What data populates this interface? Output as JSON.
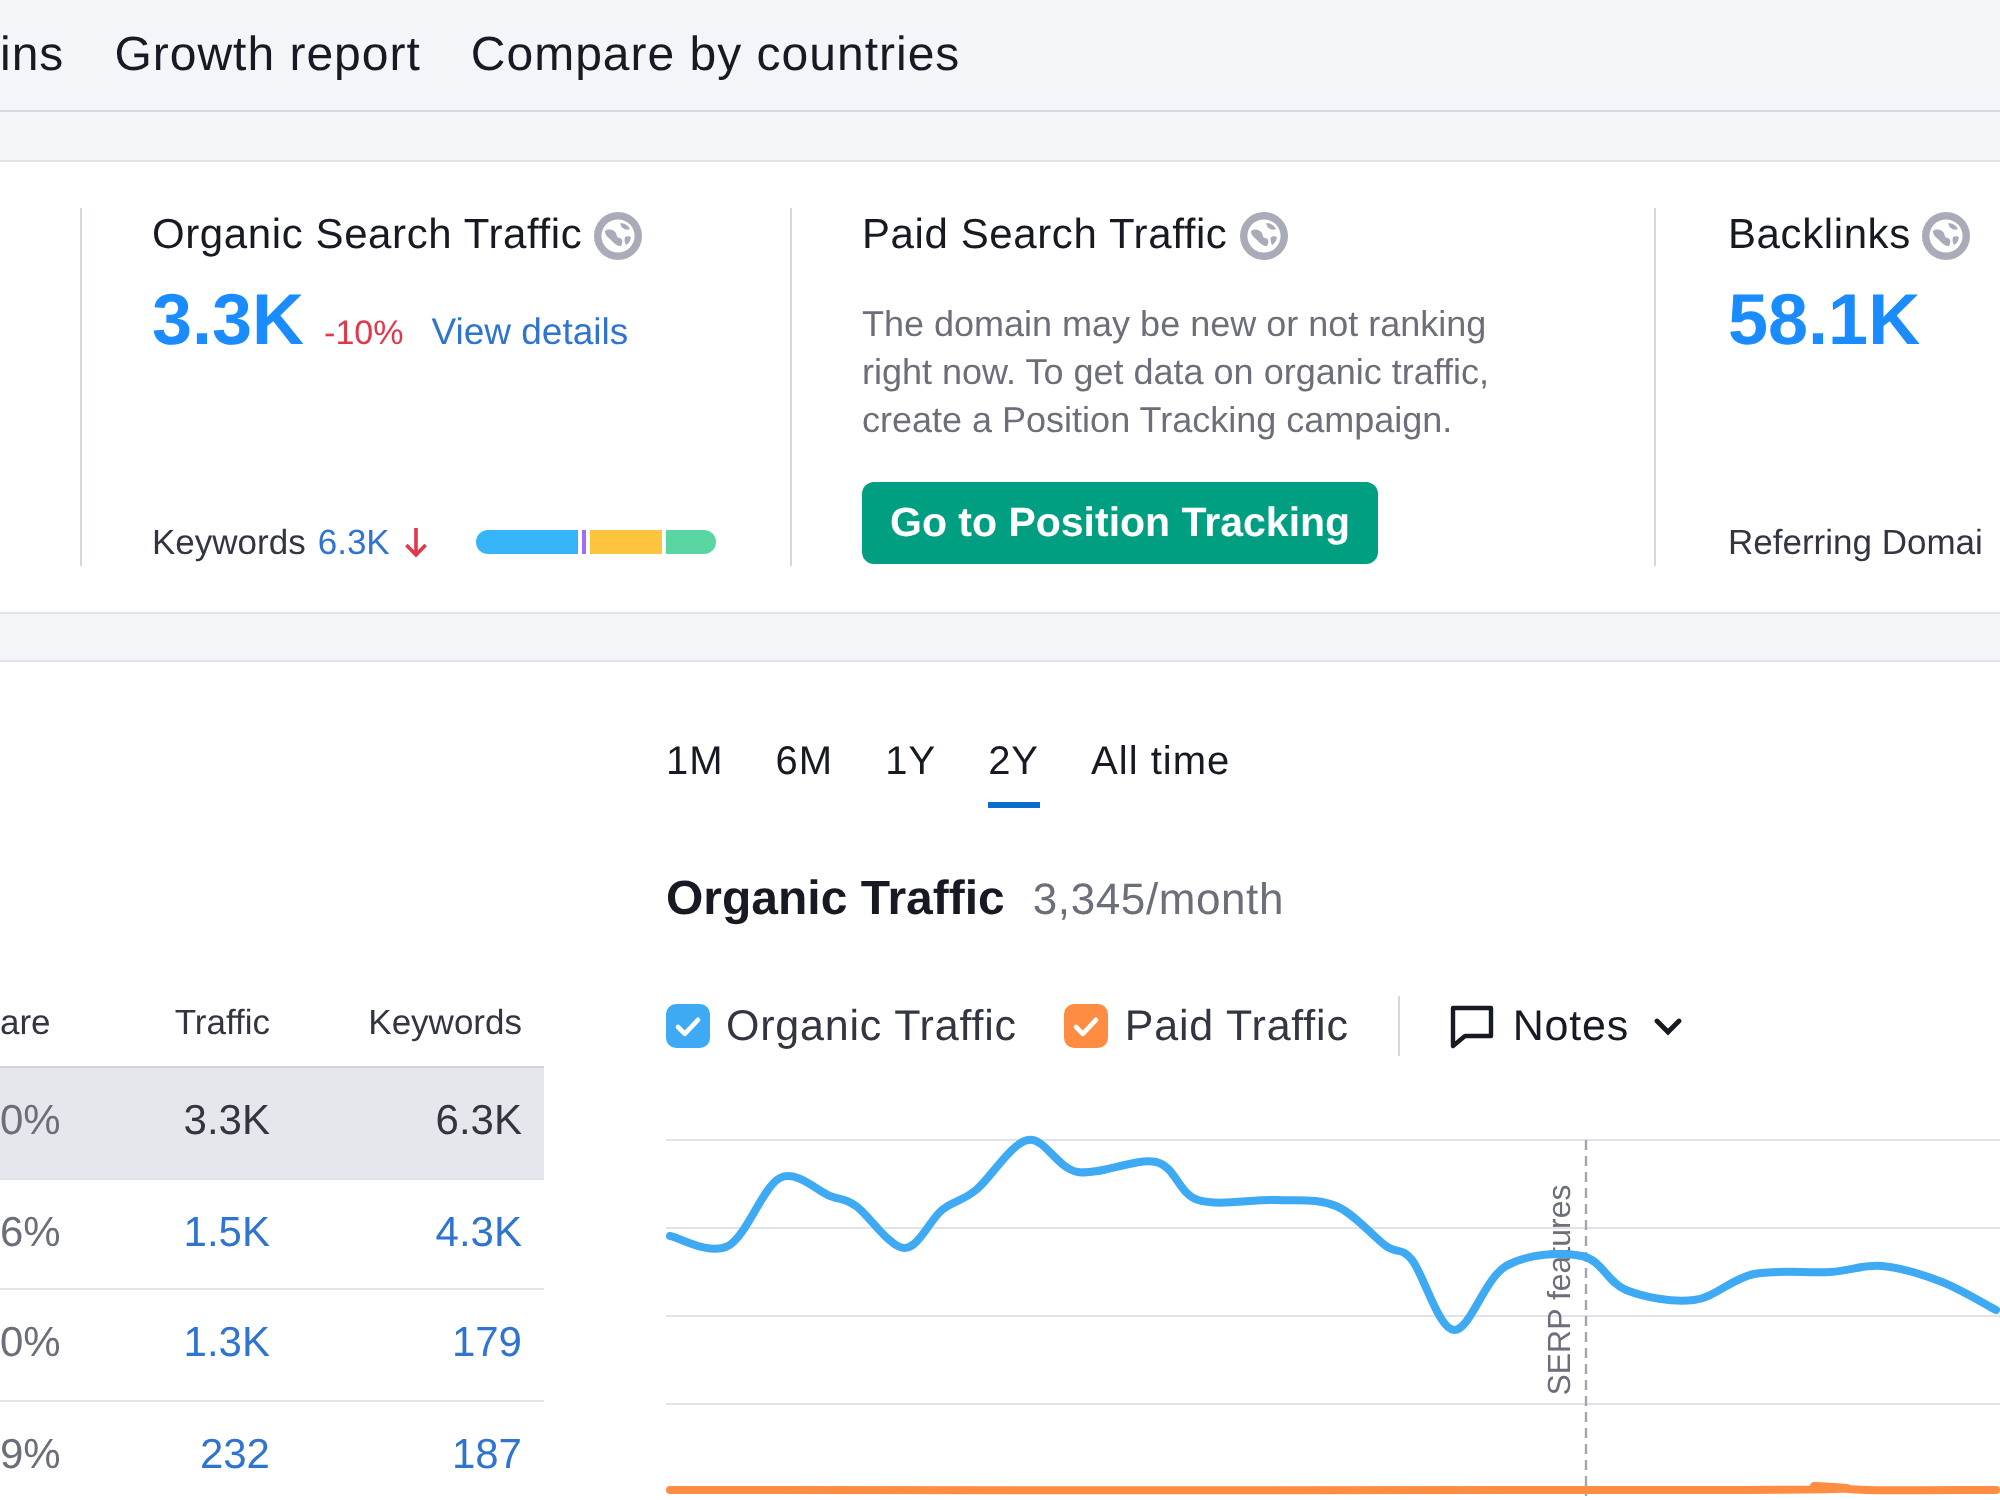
{
  "nav_tabs": [
    "ins",
    "Growth report",
    "Compare by countries"
  ],
  "summary_cards": [
    {
      "kind": "metric",
      "title": "Organic Search Traffic",
      "value": "3.3K",
      "change": "-10%",
      "link": "View details",
      "footer_label": "Keywords",
      "footer_value": "6.3K",
      "falling": true,
      "distribution": [
        {
          "level": 0.44,
          "color": "#36b4f8"
        },
        {
          "level": 0.035,
          "color": "#a26cf7"
        },
        {
          "level": 0.315,
          "color": "#ffc43d"
        },
        {
          "level": 0.21,
          "color": "#5ad6a3"
        }
      ]
    },
    {
      "kind": "notice",
      "title": "Paid Search Traffic",
      "message": "The domain may be new or not ranking right now. To get data on organic traffic, create a Position Tracking campaign.",
      "button": "Go to Position Tracking"
    },
    {
      "kind": "metric",
      "title": "Backlinks",
      "value": "58.1K",
      "footer_label": "Referring Domai"
    }
  ],
  "table": {
    "columns": [
      "are",
      "Traffic",
      "Keywords"
    ],
    "rows": [
      {
        "selected": true,
        "cells": [
          "0%",
          "3.3K",
          "6.3K"
        ]
      },
      {
        "selected": false,
        "cells": [
          "6%",
          "1.5K",
          "4.3K"
        ]
      },
      {
        "selected": false,
        "cells": [
          "0%",
          "1.3K",
          "179"
        ]
      },
      {
        "selected": false,
        "cells": [
          "9%",
          "232",
          "187"
        ]
      }
    ]
  },
  "periods": [
    {
      "label": "1M",
      "selected": false
    },
    {
      "label": "6M",
      "selected": false
    },
    {
      "label": "1Y",
      "selected": false
    },
    {
      "label": "2Y",
      "selected": true
    },
    {
      "label": "All time",
      "selected": false
    }
  ],
  "traffic_chart": {
    "title": "Organic Traffic",
    "subtitle": "3,345/month",
    "legend": [
      {
        "label": "Organic Traffic",
        "checked": true,
        "color": "#3faaf4"
      },
      {
        "label": "Paid Traffic",
        "checked": true,
        "color": "#ff8c43"
      }
    ],
    "notes_button": "Notes",
    "annotation": "SERP features"
  }
}
